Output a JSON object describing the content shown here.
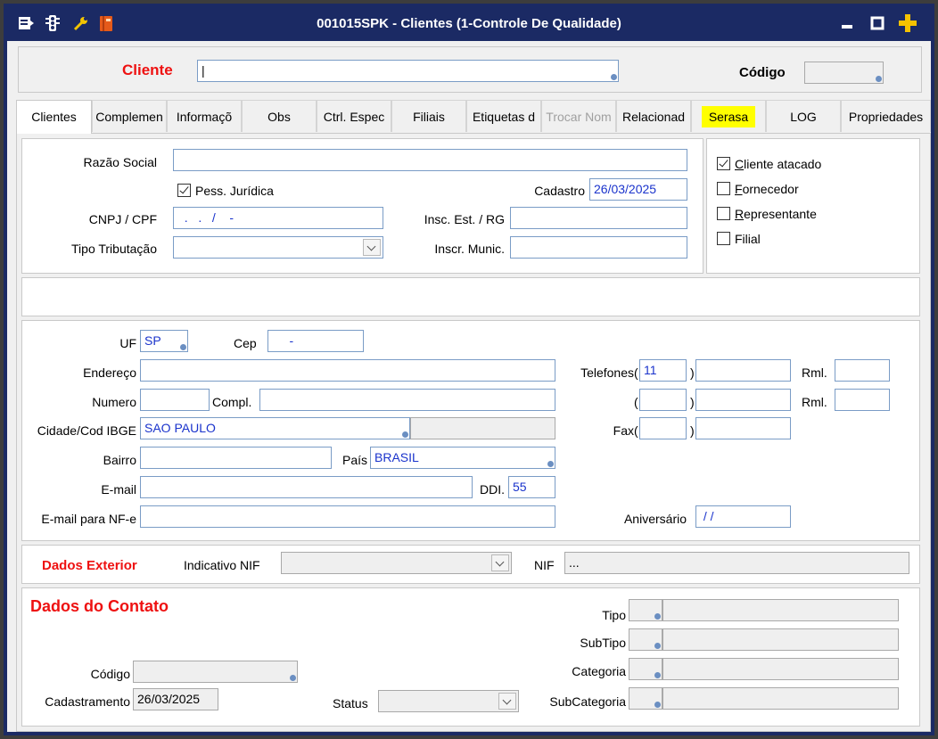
{
  "window": {
    "title": "001015SPK - Clientes (1-Controle De Qualidade)"
  },
  "search": {
    "cliente_label": "Cliente",
    "cliente_value": "|",
    "codigo_label": "Código",
    "codigo_value": ""
  },
  "tabs": [
    "Clientes",
    "Complemen",
    "Informaçõ",
    "Obs",
    "Ctrl. Espec",
    "Filiais",
    "Etiquetas d",
    "Trocar Nom",
    "Relacionad",
    "Serasa",
    "LOG",
    "Propriedades"
  ],
  "general": {
    "razao_social_label": "Razão Social",
    "razao_social_value": "",
    "pess_juridica_label": "Pess. Jurídica",
    "pess_juridica_checked": true,
    "cadastro_label": "Cadastro",
    "cadastro_value": "26/03/2025",
    "cnpj_label": "CNPJ / CPF",
    "cnpj_value": "  .   .   /    -",
    "insc_est_label": "Insc. Est. / RG",
    "insc_est_value": "",
    "tipo_trib_label": "Tipo Tributação",
    "tipo_trib_value": "",
    "inscr_munic_label": "Inscr. Munic.",
    "inscr_munic_value": ""
  },
  "flags": [
    {
      "label": "Cliente atacado",
      "checked": true
    },
    {
      "label": "Fornecedor",
      "checked": false
    },
    {
      "label": "Representante",
      "checked": false
    },
    {
      "label": "Filial",
      "checked": false
    }
  ],
  "address": {
    "uf_label": "UF",
    "uf_value": "SP",
    "cep_label": "Cep",
    "cep_value": "     -",
    "endereco_label": "Endereço",
    "endereco_value": "",
    "numero_label": "Numero",
    "numero_value": "",
    "compl_label": "Compl.",
    "compl_value": "",
    "cidade_label": "Cidade/Cod IBGE",
    "cidade_value": "SAO PAULO",
    "ibge_value": "",
    "bairro_label": "Bairro",
    "bairro_value": "",
    "pais_label": "País",
    "pais_value": "BRASIL",
    "email_label": "E-mail",
    "email_value": "",
    "ddi_label": "DDI.",
    "ddi_value": "55",
    "email_nfe_label": "E-mail para NF-e",
    "email_nfe_value": "",
    "telefones_label": "Telefones",
    "tel1_ddd": "11",
    "tel1_num": "",
    "tel2_ddd": "",
    "tel2_num": "",
    "rml_label": "Rml.",
    "rml1_value": "",
    "rml2_value": "",
    "fax_label": "Fax",
    "fax_ddd": "",
    "fax_num": "",
    "aniversario_label": "Aniversário",
    "aniversario_value": " / /"
  },
  "exterior": {
    "title": "Dados Exterior",
    "indicativo_label": "Indicativo NIF",
    "indicativo_value": "",
    "nif_label": "NIF",
    "nif_value": "..."
  },
  "contato": {
    "title": "Dados do Contato",
    "codigo_label": "Código",
    "codigo_value": "",
    "cadastramento_label": "Cadastramento",
    "cadastramento_value": "26/03/2025",
    "status_label": "Status",
    "status_value": "",
    "tipo_label": "Tipo",
    "subtipo_label": "SubTipo",
    "categoria_label": "Categoria",
    "subcategoria_label": "SubCategoria"
  }
}
